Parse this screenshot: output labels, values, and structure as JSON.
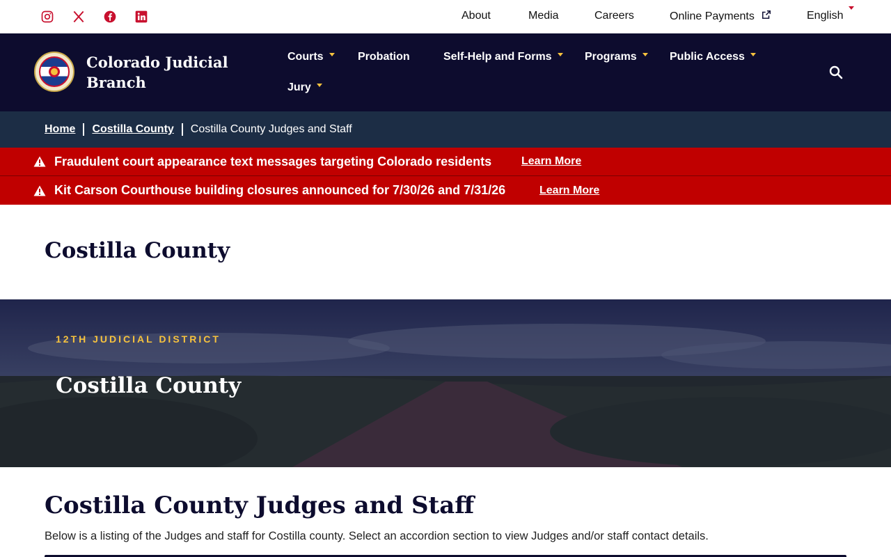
{
  "utility": {
    "social": [
      "instagram-icon",
      "x-icon",
      "facebook-icon",
      "linkedin-icon"
    ],
    "links": {
      "about": "About",
      "media": "Media",
      "careers": "Careers",
      "payments": "Online Payments",
      "language": "English"
    }
  },
  "header": {
    "brand_line1": "Colorado Judicial",
    "brand_line2": "Branch",
    "nav": {
      "courts": "Courts",
      "probation": "Probation",
      "selfhelp": "Self-Help and Forms",
      "programs": "Programs",
      "public_access": "Public Access",
      "jury": "Jury"
    }
  },
  "breadcrumb": {
    "home": "Home",
    "county": "Costilla County",
    "current": "Costilla County Judges and Staff"
  },
  "alerts": [
    {
      "message": "Fraudulent court appearance text messages targeting Colorado residents",
      "link": "Learn More"
    },
    {
      "message": "Kit Carson Courthouse building closures announced for 7/30/26 and 7/31/26",
      "link": "Learn More"
    }
  ],
  "page": {
    "heading": "Costilla County"
  },
  "hero": {
    "eyebrow": "12TH JUDICIAL DISTRICT",
    "title": "Costilla County"
  },
  "content": {
    "title": "Costilla County Judges and Staff",
    "description": "Below is a listing of the Judges and staff for Costilla county. Select an accordion section to view Judges and/or staff contact details."
  },
  "colors": {
    "navy": "#0d0c2e",
    "breadcrumb_bg": "#1c2d45",
    "alert_red": "#c00000",
    "accent_gold": "#f6c23e",
    "social_red": "#c8102e"
  }
}
